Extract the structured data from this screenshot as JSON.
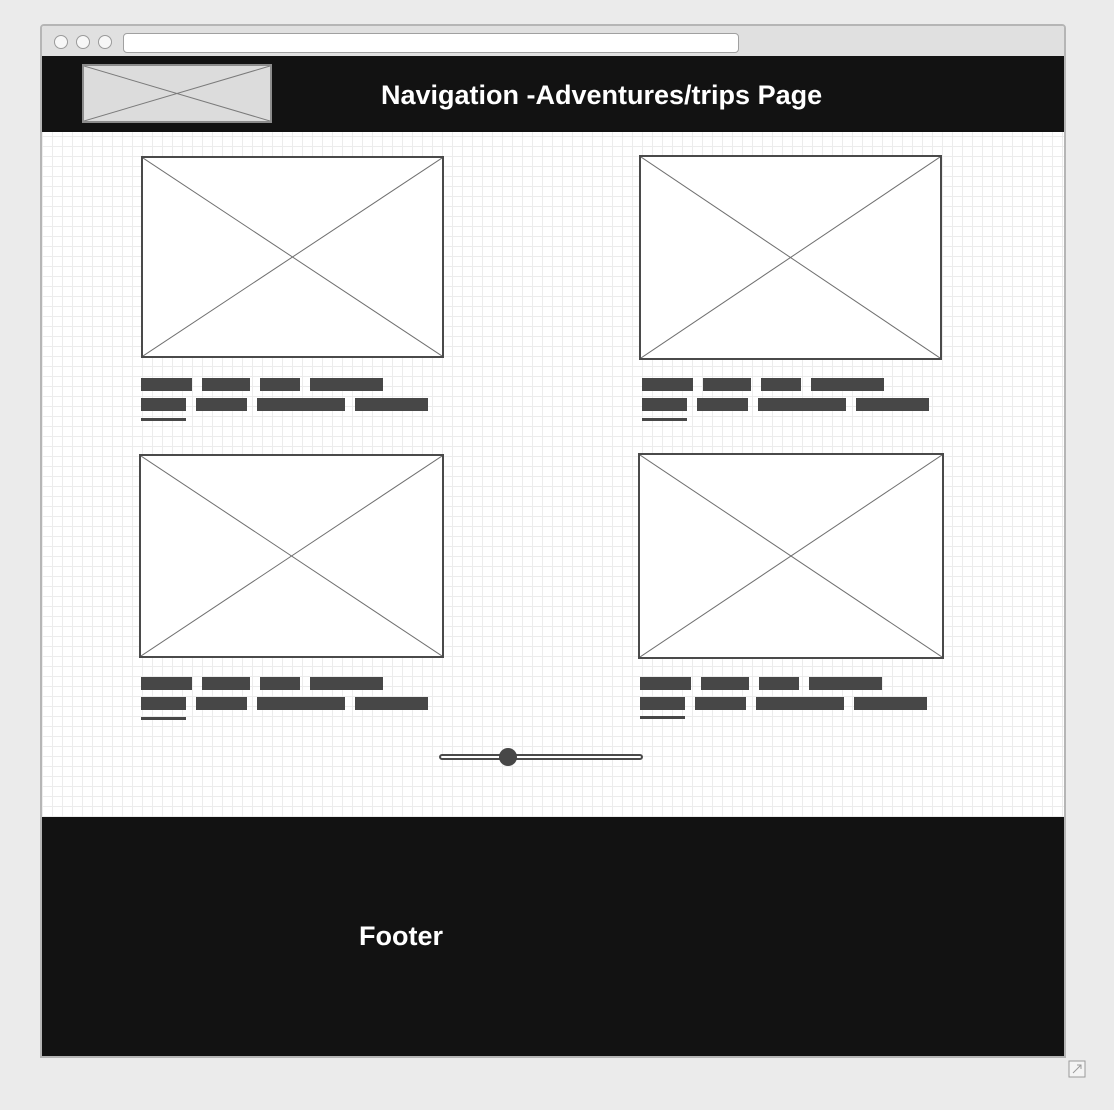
{
  "header": {
    "logo_icon": "image-placeholder-icon",
    "title": "Navigation -Adventures/trips Page"
  },
  "cards": [
    {
      "image_icon": "image-placeholder-icon",
      "text": "text-placeholder-lines"
    },
    {
      "image_icon": "image-placeholder-icon",
      "text": "text-placeholder-lines"
    },
    {
      "image_icon": "image-placeholder-icon",
      "text": "text-placeholder-lines"
    },
    {
      "image_icon": "image-placeholder-icon",
      "text": "text-placeholder-lines"
    }
  ],
  "slider": {
    "value_fraction": 0.34
  },
  "footer": {
    "label": "Footer"
  },
  "colors": {
    "header_bg": "#121212",
    "footer_bg": "#121212",
    "text_bar": "#474747",
    "grid_line": "#ececec",
    "window_bg": "#ebebeb"
  }
}
